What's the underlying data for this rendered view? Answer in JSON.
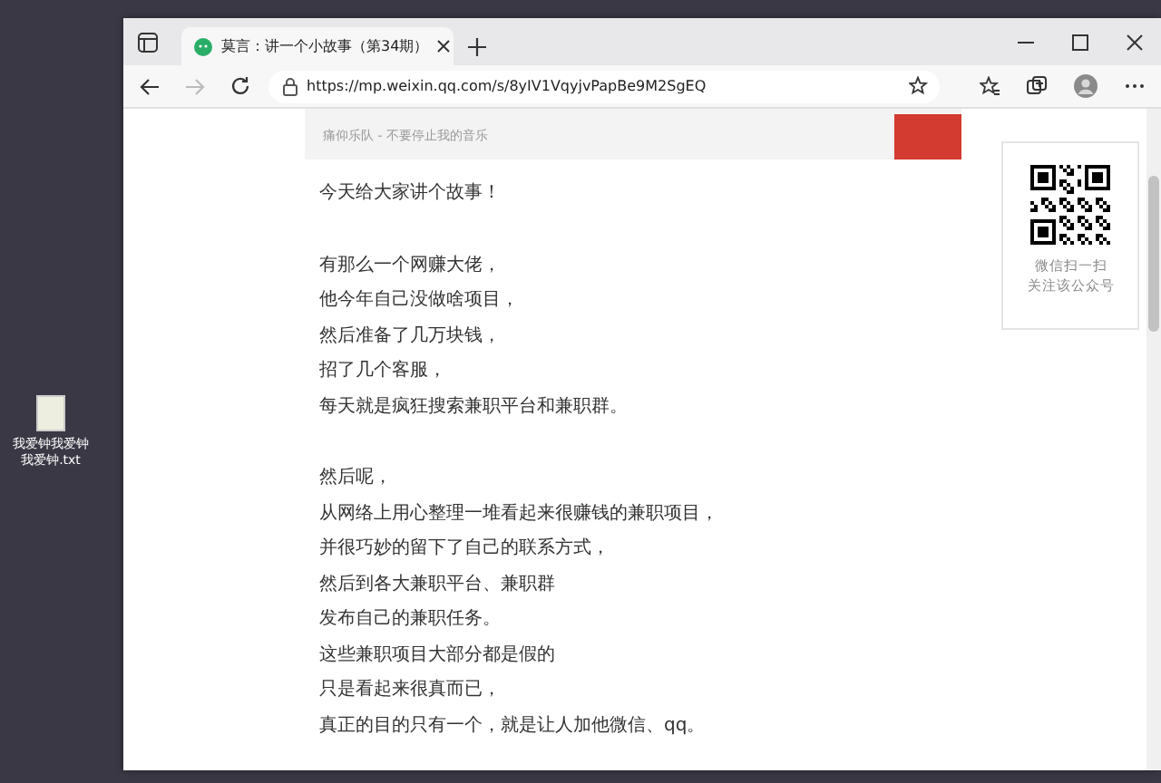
{
  "desktop": {
    "file_icon_label": "我爱钟我爱钟我爱钟.txt"
  },
  "browser": {
    "tab_title": "莫言：讲一个小故事（第34期）",
    "url": "https://mp.weixin.qq.com/s/8yIV1VqyjvPapBe9M2SgEQ"
  },
  "music_card": {
    "subtitle": "痛仰乐队 - 不要停止我的音乐"
  },
  "article": {
    "sections": [
      [
        "今天给大家讲个故事！"
      ],
      [
        "有那么一个网赚大佬，",
        "他今年自己没做啥项目，",
        "然后准备了几万块钱，",
        "招了几个客服，",
        "每天就是疯狂搜索兼职平台和兼职群。"
      ],
      [
        "然后呢，",
        "从网络上用心整理一堆看起来很赚钱的兼职项目，",
        "并很巧妙的留下了自己的联系方式，",
        "然后到各大兼职平台、兼职群",
        "发布自己的兼职任务。",
        "这些兼职项目大部分都是假的",
        "只是看起来很真而已，",
        "真正的目的只有一个，就是让人加他微信、qq。"
      ]
    ]
  },
  "qr_card": {
    "lines": [
      "微信扫一扫",
      "关注该公众号"
    ]
  }
}
